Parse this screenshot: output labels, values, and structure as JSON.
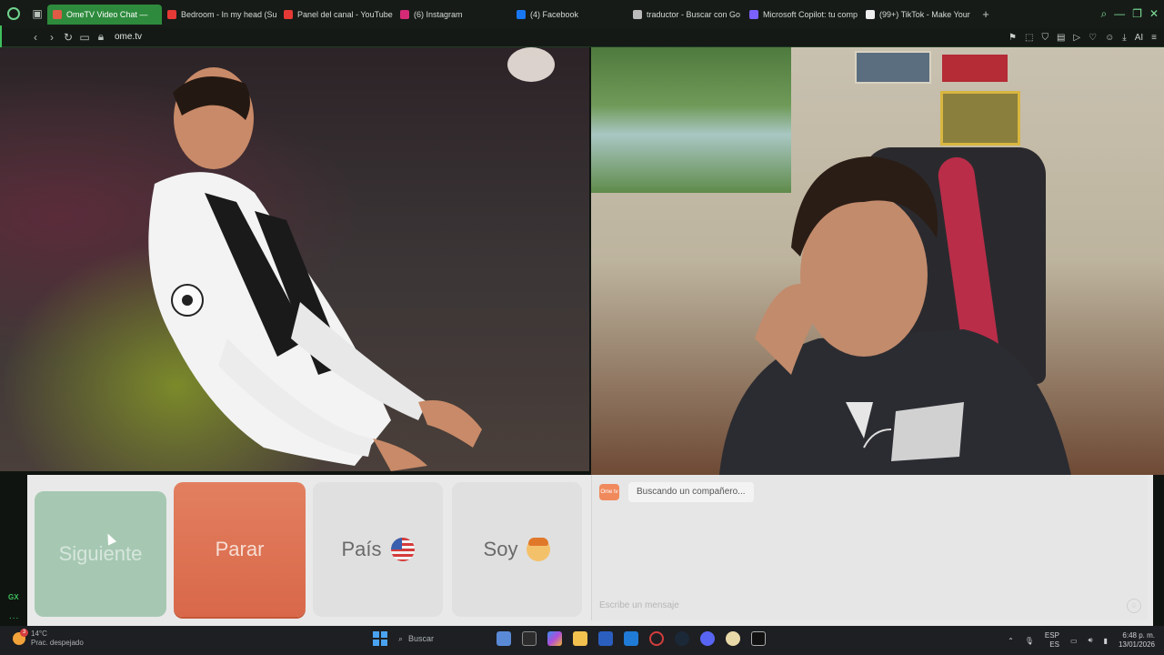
{
  "browser": {
    "tabs": [
      {
        "label": "OmeTV Video Chat —",
        "active": true,
        "color": "#e05a45"
      },
      {
        "label": "Bedroom - In my head (Su",
        "active": false,
        "color": "#e53935"
      },
      {
        "label": "Panel del canal - YouTube",
        "active": false,
        "color": "#e53935"
      },
      {
        "label": "(6) Instagram",
        "active": false,
        "color": "#d62976"
      },
      {
        "label": "(4) Facebook",
        "active": false,
        "color": "#1877f2"
      },
      {
        "label": "traductor - Buscar con Go",
        "active": false,
        "color": "#bbbbbb"
      },
      {
        "label": "Microsoft Copilot: tu comp",
        "active": false,
        "color": "#7b61ff"
      },
      {
        "label": "(99+) TikTok - Make Your",
        "active": false,
        "color": "#eeeeee"
      }
    ],
    "url": "ome.tv",
    "ai_label": "AI"
  },
  "sidebar": {
    "gx_label": "GX",
    "more_label": "..."
  },
  "controls": {
    "next_label": "Siguiente",
    "stop_label": "Parar",
    "country_label": "País",
    "gender_label": "Soy"
  },
  "chat": {
    "logo_text": "Ome tv",
    "status_text": "Buscando un compañero...",
    "input_placeholder": "Escribe un mensaje"
  },
  "taskbar": {
    "weather_temp": "14°C",
    "weather_desc": "Prac. despejado",
    "notification_count": "3",
    "search_placeholder": "Buscar",
    "language": "ESP",
    "language_sub": "ES",
    "time": "6:48 p. m.",
    "date": "13/01/2026"
  },
  "colors": {
    "accent_green": "#2e8b3d",
    "stop_button": "#d9684a",
    "next_button": "#a6c8b2"
  }
}
